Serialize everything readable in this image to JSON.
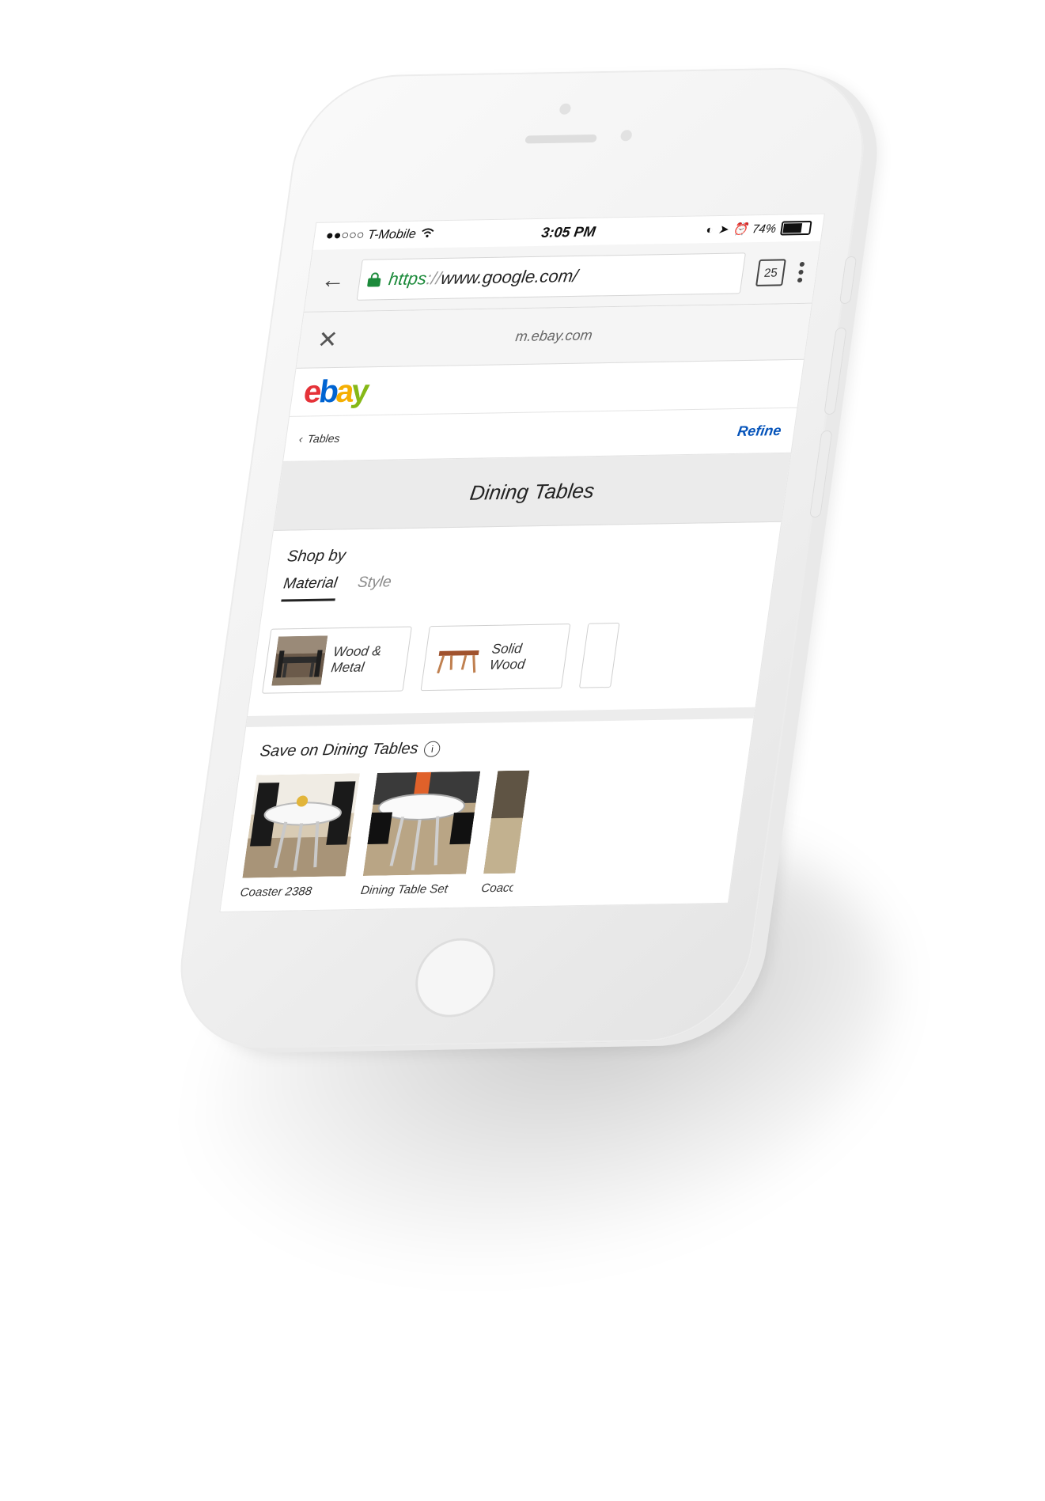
{
  "status_bar": {
    "carrier": "●●○○○ T-Mobile",
    "time": "3:05 PM",
    "battery": "74%",
    "battery_level": 0.74
  },
  "browser": {
    "url_scheme": "https",
    "url_rest": "www.google.com/",
    "tab_count": "25"
  },
  "amp_viewer": {
    "domain": "m.ebay.com"
  },
  "ebay": {
    "breadcrumb": "Tables",
    "refine_label": "Refine",
    "category_title": "Dining Tables"
  },
  "shop_by": {
    "heading": "Shop by",
    "tabs": [
      {
        "label": "Material",
        "active": true
      },
      {
        "label": "Style",
        "active": false
      }
    ],
    "chips": [
      {
        "label": "Wood & Metal"
      },
      {
        "label": "Solid Wood"
      }
    ]
  },
  "deals": {
    "heading": "Save on Dining Tables",
    "products": [
      {
        "title": "Coaster 2388"
      },
      {
        "title": "Dining Table Set"
      },
      {
        "title": "Coaco"
      }
    ]
  }
}
